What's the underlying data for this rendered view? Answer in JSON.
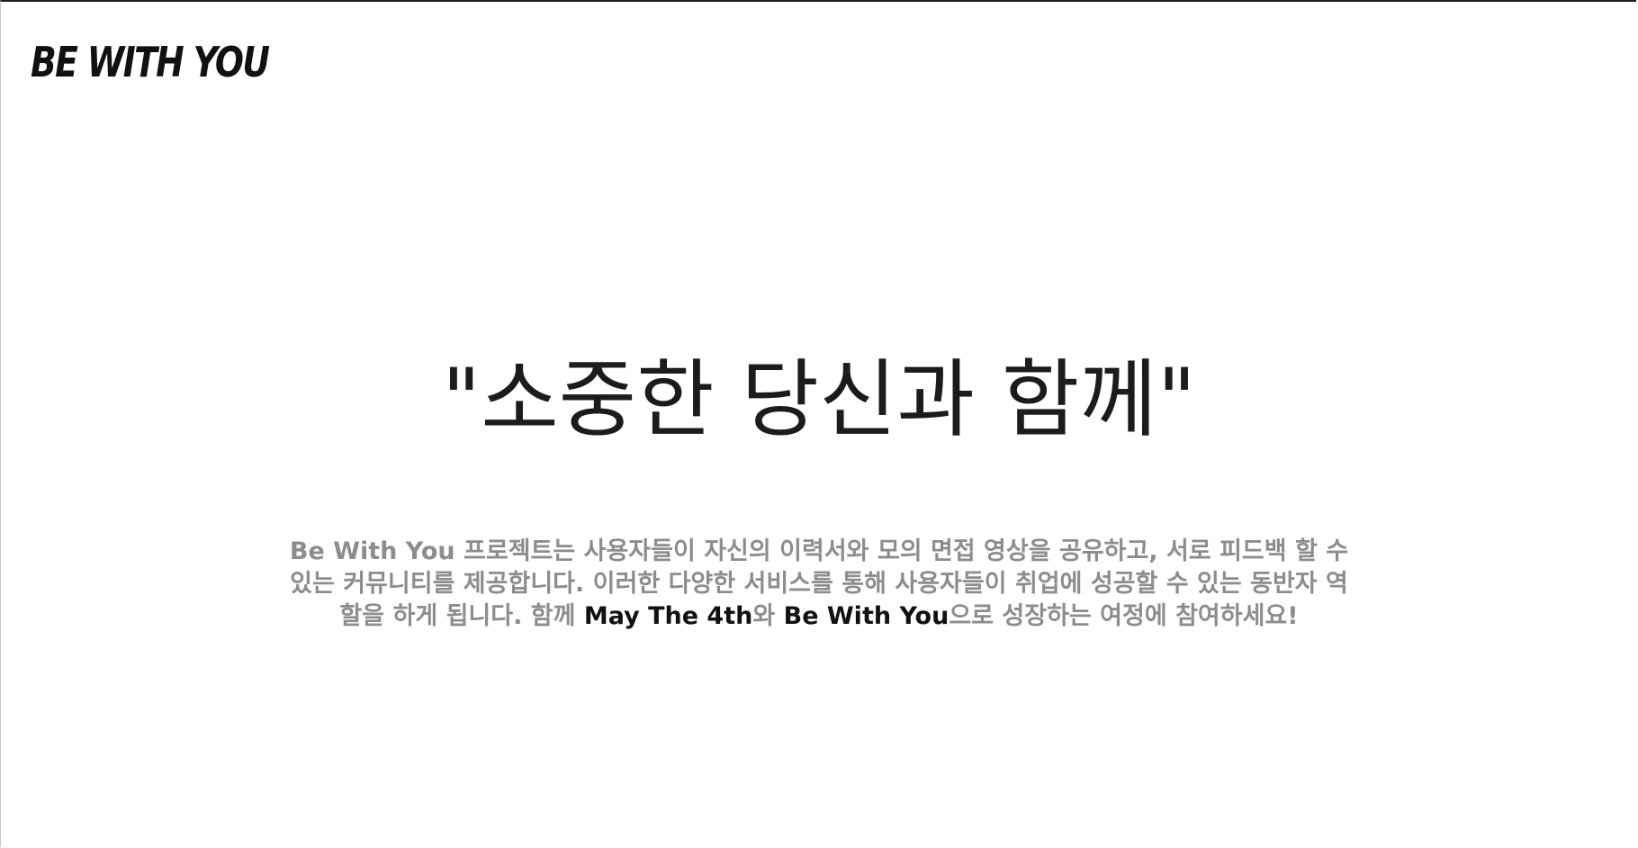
{
  "brand": {
    "logo_text": "BE WITH YOU"
  },
  "hero": {
    "title": "\"소중한 당신과 함께\""
  },
  "description": {
    "part1": "Be With You 프로젝트는 사용자들이 자신의 이력서와 모의 면접 영상을 공유하고, 서로 피드백 할 수 있는 커뮤니티를 제공합니다. 이러한 다양한 서비스를 통해 사용자들이 취업에 성공할 수 있는 동반자 역할을 하게 됩니다. 함께 ",
    "highlight1": "May The 4th",
    "part2": "와 ",
    "highlight2": "Be With You",
    "part3": "으로 성장하는 여정에 참여하세요!"
  },
  "colors": {
    "background": "#ffffff",
    "title_text": "#1c1c1c",
    "body_text": "#8d8d8d",
    "highlight_text": "#111111"
  }
}
